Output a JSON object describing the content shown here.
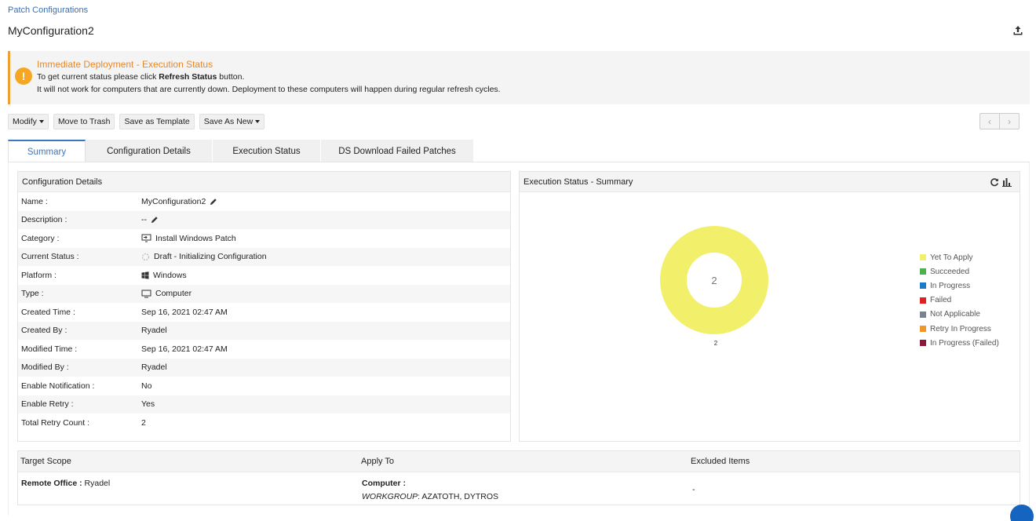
{
  "breadcrumb": "Patch Configurations",
  "page_title": "MyConfiguration2",
  "alert": {
    "title": "Immediate Deployment - Execution Status",
    "line1_prefix": "To get current status please click ",
    "line1_bold": "Refresh Status",
    "line1_suffix": " button.",
    "line2": "It will not work for computers that are currently down. Deployment to these computers will happen during regular refresh cycles."
  },
  "toolbar": {
    "modify": "Modify",
    "move_to_trash": "Move to Trash",
    "save_as_template": "Save as Template",
    "save_as_new": "Save As New"
  },
  "tabs": [
    "Summary",
    "Configuration Details",
    "Execution Status",
    "DS Download Failed Patches"
  ],
  "details": {
    "title": "Configuration Details",
    "rows": [
      {
        "label": "Name :",
        "value": "MyConfiguration2"
      },
      {
        "label": "Description :",
        "value": "--"
      },
      {
        "label": "Category :",
        "value": "Install Windows Patch"
      },
      {
        "label": "Current Status :",
        "value": "Draft - Initializing Configuration"
      },
      {
        "label": "Platform :",
        "value": "Windows"
      },
      {
        "label": "Type :",
        "value": "Computer"
      },
      {
        "label": "Created Time :",
        "value": "Sep 16, 2021 02:47 AM"
      },
      {
        "label": "Created By :",
        "value": "Ryadel"
      },
      {
        "label": "Modified Time :",
        "value": "Sep 16, 2021 02:47 AM"
      },
      {
        "label": "Modified By :",
        "value": "Ryadel"
      },
      {
        "label": "Enable Notification :",
        "value": "No"
      },
      {
        "label": "Enable Retry :",
        "value": "Yes"
      },
      {
        "label": "Total Retry Count :",
        "value": "2"
      }
    ]
  },
  "exec_summary": {
    "title": "Execution Status - Summary",
    "center_value": "2",
    "below_label": "2",
    "legend": [
      {
        "name": "Yet To Apply",
        "color": "#f2f06a"
      },
      {
        "name": "Succeeded",
        "color": "#4caf50"
      },
      {
        "name": "In Progress",
        "color": "#1e7ac8"
      },
      {
        "name": "Failed",
        "color": "#e02020"
      },
      {
        "name": "Not Applicable",
        "color": "#7a8290"
      },
      {
        "name": "Retry In Progress",
        "color": "#f0962a"
      },
      {
        "name": "In Progress (Failed)",
        "color": "#8a1a3a"
      }
    ],
    "values": [
      2,
      0,
      0,
      0,
      0,
      0,
      0
    ]
  },
  "scope": {
    "headers": [
      "Target Scope",
      "Apply To",
      "Excluded Items"
    ],
    "target_label": "Remote Office : ",
    "target_value": "Ryadel",
    "apply_label": "Computer :",
    "apply_group": "WORKGROUP",
    "apply_value": ": AZATOTH, DYTROS",
    "excluded": "-"
  },
  "colors": {
    "accent": "#3a78c0",
    "warning": "#f5a623",
    "donut": "#f2f06a"
  }
}
